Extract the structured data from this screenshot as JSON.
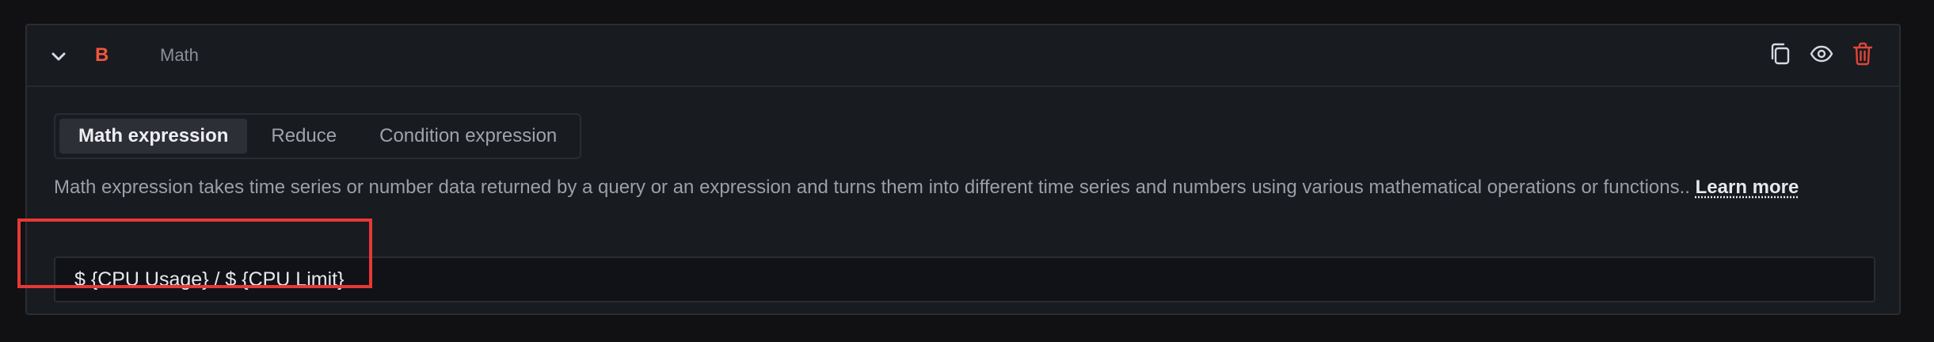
{
  "colors": {
    "ref_id": "#f2553d",
    "delete_icon": "#e0443a",
    "highlight_box": "#e53935"
  },
  "query": {
    "ref_id": "B",
    "type_label": "Math",
    "collapse_icon": "chevron-down-icon",
    "actions": [
      {
        "name": "duplicate-query-button",
        "icon": "copy-icon"
      },
      {
        "name": "toggle-visibility-button",
        "icon": "eye-icon"
      },
      {
        "name": "delete-query-button",
        "icon": "trash-icon"
      }
    ]
  },
  "tabs": [
    {
      "label": "Math expression",
      "active": true
    },
    {
      "label": "Reduce",
      "active": false
    },
    {
      "label": "Condition expression",
      "active": false
    }
  ],
  "description": {
    "text": "Math expression takes time series or number data returned by a query or an expression and turns them into different time series and numbers using various mathematical operations or functions.. ",
    "link": "Learn more"
  },
  "expression": {
    "value": "$ {CPU Usage} / $ {CPU Limit}"
  }
}
